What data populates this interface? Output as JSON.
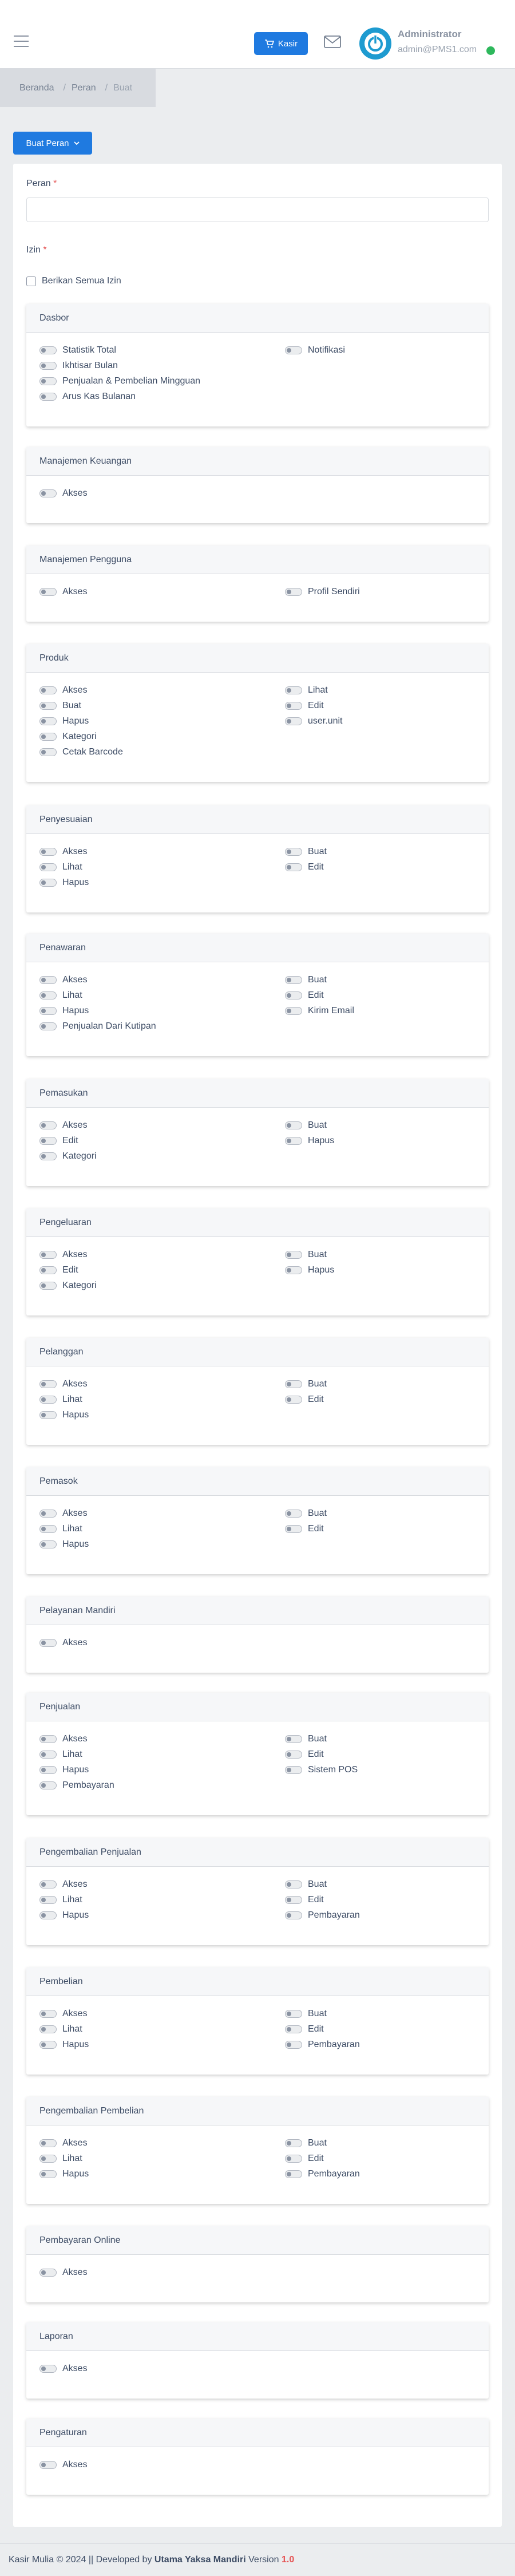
{
  "header": {
    "kasir_label": "Kasir",
    "user_name": "Administrator",
    "user_email": "admin@PMS1.com"
  },
  "breadcrumb": [
    "Beranda",
    "Peran",
    "Buat"
  ],
  "create_button_label": "Buat Peran",
  "form": {
    "role_label": "Peran",
    "role_value": "",
    "perm_label": "Izin",
    "required_mark": "*",
    "grant_all_label": "Berikan Semua Izin"
  },
  "sections": [
    {
      "title": "Dasbor",
      "left": [
        "Statistik Total",
        "Ikhtisar Bulan",
        "Penjualan & Pembelian Mingguan",
        "Arus Kas Bulanan"
      ],
      "right": [
        "Notifikasi"
      ]
    },
    {
      "title": "Manajemen Keuangan",
      "left": [
        "Akses"
      ],
      "right": []
    },
    {
      "title": "Manajemen Pengguna",
      "left": [
        "Akses"
      ],
      "right": [
        "Profil Sendiri"
      ]
    },
    {
      "title": "Produk",
      "left": [
        "Akses",
        "Buat",
        "Hapus",
        "Kategori",
        "Cetak Barcode"
      ],
      "right": [
        "Lihat",
        "Edit",
        "user.unit"
      ]
    },
    {
      "title": "Penyesuaian",
      "left": [
        "Akses",
        "Lihat",
        "Hapus"
      ],
      "right": [
        "Buat",
        "Edit"
      ]
    },
    {
      "title": "Penawaran",
      "left": [
        "Akses",
        "Lihat",
        "Hapus",
        "Penjualan Dari Kutipan"
      ],
      "right": [
        "Buat",
        "Edit",
        "Kirim Email"
      ]
    },
    {
      "title": "Pemasukan",
      "left": [
        "Akses",
        "Edit",
        "Kategori"
      ],
      "right": [
        "Buat",
        "Hapus"
      ]
    },
    {
      "title": "Pengeluaran",
      "left": [
        "Akses",
        "Edit",
        "Kategori"
      ],
      "right": [
        "Buat",
        "Hapus"
      ]
    },
    {
      "title": "Pelanggan",
      "left": [
        "Akses",
        "Lihat",
        "Hapus"
      ],
      "right": [
        "Buat",
        "Edit"
      ]
    },
    {
      "title": "Pemasok",
      "left": [
        "Akses",
        "Lihat",
        "Hapus"
      ],
      "right": [
        "Buat",
        "Edit"
      ]
    },
    {
      "title": "Pelayanan Mandiri",
      "left": [
        "Akses"
      ],
      "right": []
    },
    {
      "title": "Penjualan",
      "left": [
        "Akses",
        "Lihat",
        "Hapus",
        "Pembayaran"
      ],
      "right": [
        "Buat",
        "Edit",
        "Sistem POS"
      ]
    },
    {
      "title": "Pengembalian Penjualan",
      "left": [
        "Akses",
        "Lihat",
        "Hapus"
      ],
      "right": [
        "Buat",
        "Edit",
        "Pembayaran"
      ]
    },
    {
      "title": "Pembelian",
      "left": [
        "Akses",
        "Lihat",
        "Hapus"
      ],
      "right": [
        "Buat",
        "Edit",
        "Pembayaran"
      ]
    },
    {
      "title": "Pengembalian Pembelian",
      "left": [
        "Akses",
        "Lihat",
        "Hapus"
      ],
      "right": [
        "Buat",
        "Edit",
        "Pembayaran"
      ]
    },
    {
      "title": "Pembayaran Online",
      "left": [
        "Akses"
      ],
      "right": []
    },
    {
      "title": "Laporan",
      "left": [
        "Akses"
      ],
      "right": []
    },
    {
      "title": "Pengaturan",
      "left": [
        "Akses"
      ],
      "right": []
    }
  ],
  "footer": {
    "text": "Kasir Mulia © 2024 || Developed by",
    "company": "Utama Yaksa Mandiri",
    "version_label": "Version",
    "version": "1.0"
  }
}
